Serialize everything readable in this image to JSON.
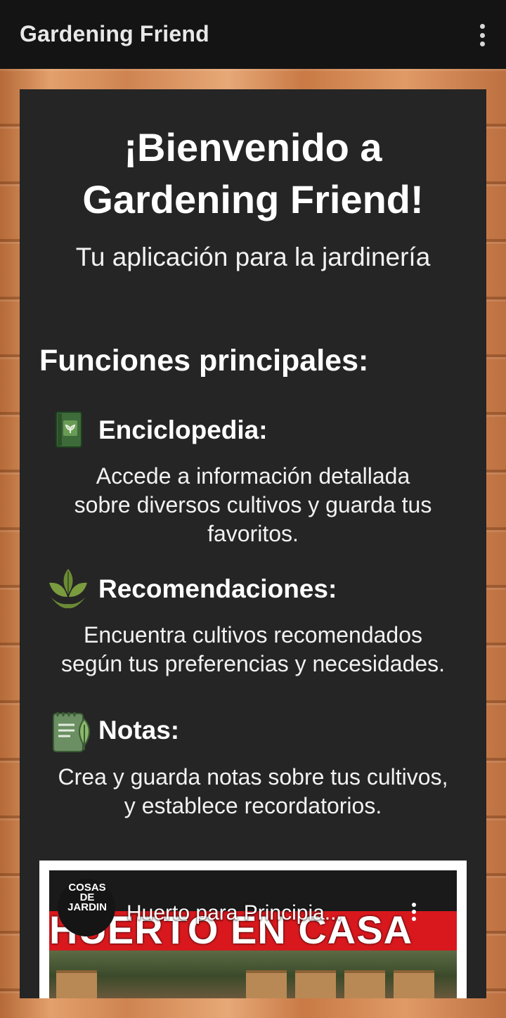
{
  "app_bar": {
    "title": "Gardening Friend",
    "menu_icon": "more-vertical-icon"
  },
  "hero": {
    "title_line1": "¡Bienvenido a",
    "title_line2": "Gardening Friend!",
    "subtitle": "Tu aplicación para la jardinería"
  },
  "features": {
    "heading": "Funciones principales:",
    "items": [
      {
        "icon": "book-plant-icon",
        "title": "Enciclopedia:",
        "desc_line1": "Accede a información detallada",
        "desc_line2": "sobre diversos cultivos y guarda tus",
        "desc_line3": "favoritos."
      },
      {
        "icon": "leaves-icon",
        "title": "Recomendaciones:",
        "desc_line1": "Encuentra cultivos recomendados",
        "desc_line2": "según tus preferencias y necesidades."
      },
      {
        "icon": "notes-leaf-icon",
        "title": "Notas:",
        "desc_line1": "Crea y guarda notas sobre tus cultivos,",
        "desc_line2": "y establece recordatorios."
      }
    ]
  },
  "video": {
    "title": "Huerto para Principia...",
    "channel_line1": "COSAS DE",
    "channel_line2": "JARDIN",
    "thumbnail_text": "HUERTO EN CASA",
    "menu_icon": "more-vertical-icon"
  },
  "colors": {
    "app_bar": "#141414",
    "panel": "#252525",
    "wood": "#c97a45",
    "icon_green": "#5b8a4a",
    "banner_red": "#d8181d"
  }
}
